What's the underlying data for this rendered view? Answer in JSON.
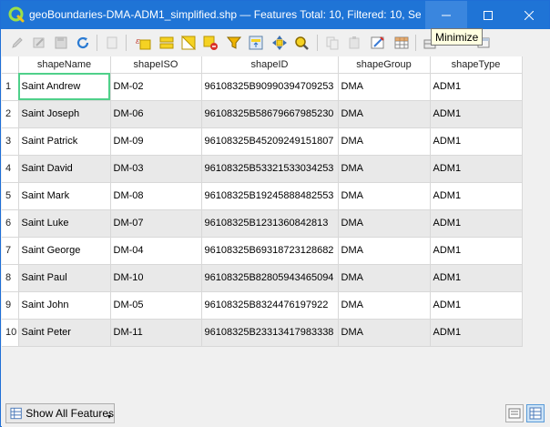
{
  "window": {
    "title": "geoBoundaries-DMA-ADM1_simplified.shp — Features Total: 10, Filtered: 10, Se...",
    "tooltip": "Minimize"
  },
  "toolbar": {
    "icons": [
      "pencil-icon",
      "multi-edit-icon",
      "save-icon",
      "reload-icon",
      "add-feature-icon",
      "delete-feature-icon",
      "select-expression-icon",
      "select-all-icon",
      "invert-selection-icon",
      "deselect-icon",
      "filter-icon",
      "move-selection-top-icon",
      "pan-to-selection-icon",
      "zoom-to-selection-icon",
      "copy-icon",
      "paste-icon",
      "field-calculator-icon",
      "conditional-format-icon",
      "new-field-icon",
      "delete-field-icon",
      "dock-icon"
    ]
  },
  "table": {
    "columns": [
      "shapeName",
      "shapeISO",
      "shapeID",
      "shapeGroup",
      "shapeType"
    ],
    "rows": [
      {
        "num": "1",
        "cells": [
          "Saint Andrew",
          "DM-02",
          "96108325B90990394709253",
          "DMA",
          "ADM1"
        ]
      },
      {
        "num": "2",
        "cells": [
          "Saint Joseph",
          "DM-06",
          "96108325B58679667985230",
          "DMA",
          "ADM1"
        ]
      },
      {
        "num": "3",
        "cells": [
          "Saint Patrick",
          "DM-09",
          "96108325B45209249151807",
          "DMA",
          "ADM1"
        ]
      },
      {
        "num": "4",
        "cells": [
          "Saint David",
          "DM-03",
          "96108325B53321533034253",
          "DMA",
          "ADM1"
        ]
      },
      {
        "num": "5",
        "cells": [
          "Saint Mark",
          "DM-08",
          "96108325B19245888482553",
          "DMA",
          "ADM1"
        ]
      },
      {
        "num": "6",
        "cells": [
          "Saint Luke",
          "DM-07",
          "96108325B1231360842813",
          "DMA",
          "ADM1"
        ]
      },
      {
        "num": "7",
        "cells": [
          "Saint George",
          "DM-04",
          "96108325B69318723128682",
          "DMA",
          "ADM1"
        ]
      },
      {
        "num": "8",
        "cells": [
          "Saint Paul",
          "DM-10",
          "96108325B82805943465094",
          "DMA",
          "ADM1"
        ]
      },
      {
        "num": "9",
        "cells": [
          "Saint John",
          "DM-05",
          "96108325B8324476197922",
          "DMA",
          "ADM1"
        ]
      },
      {
        "num": "10",
        "cells": [
          "Saint Peter",
          "DM-11",
          "96108325B23313417983338",
          "DMA",
          "ADM1"
        ]
      }
    ]
  },
  "bottom": {
    "show_features_label": "Show All Features"
  },
  "colors": {
    "titlebar": "#1f74d6",
    "selection_outline": "#4fd08a",
    "alt_row": "#e9e9e9"
  }
}
